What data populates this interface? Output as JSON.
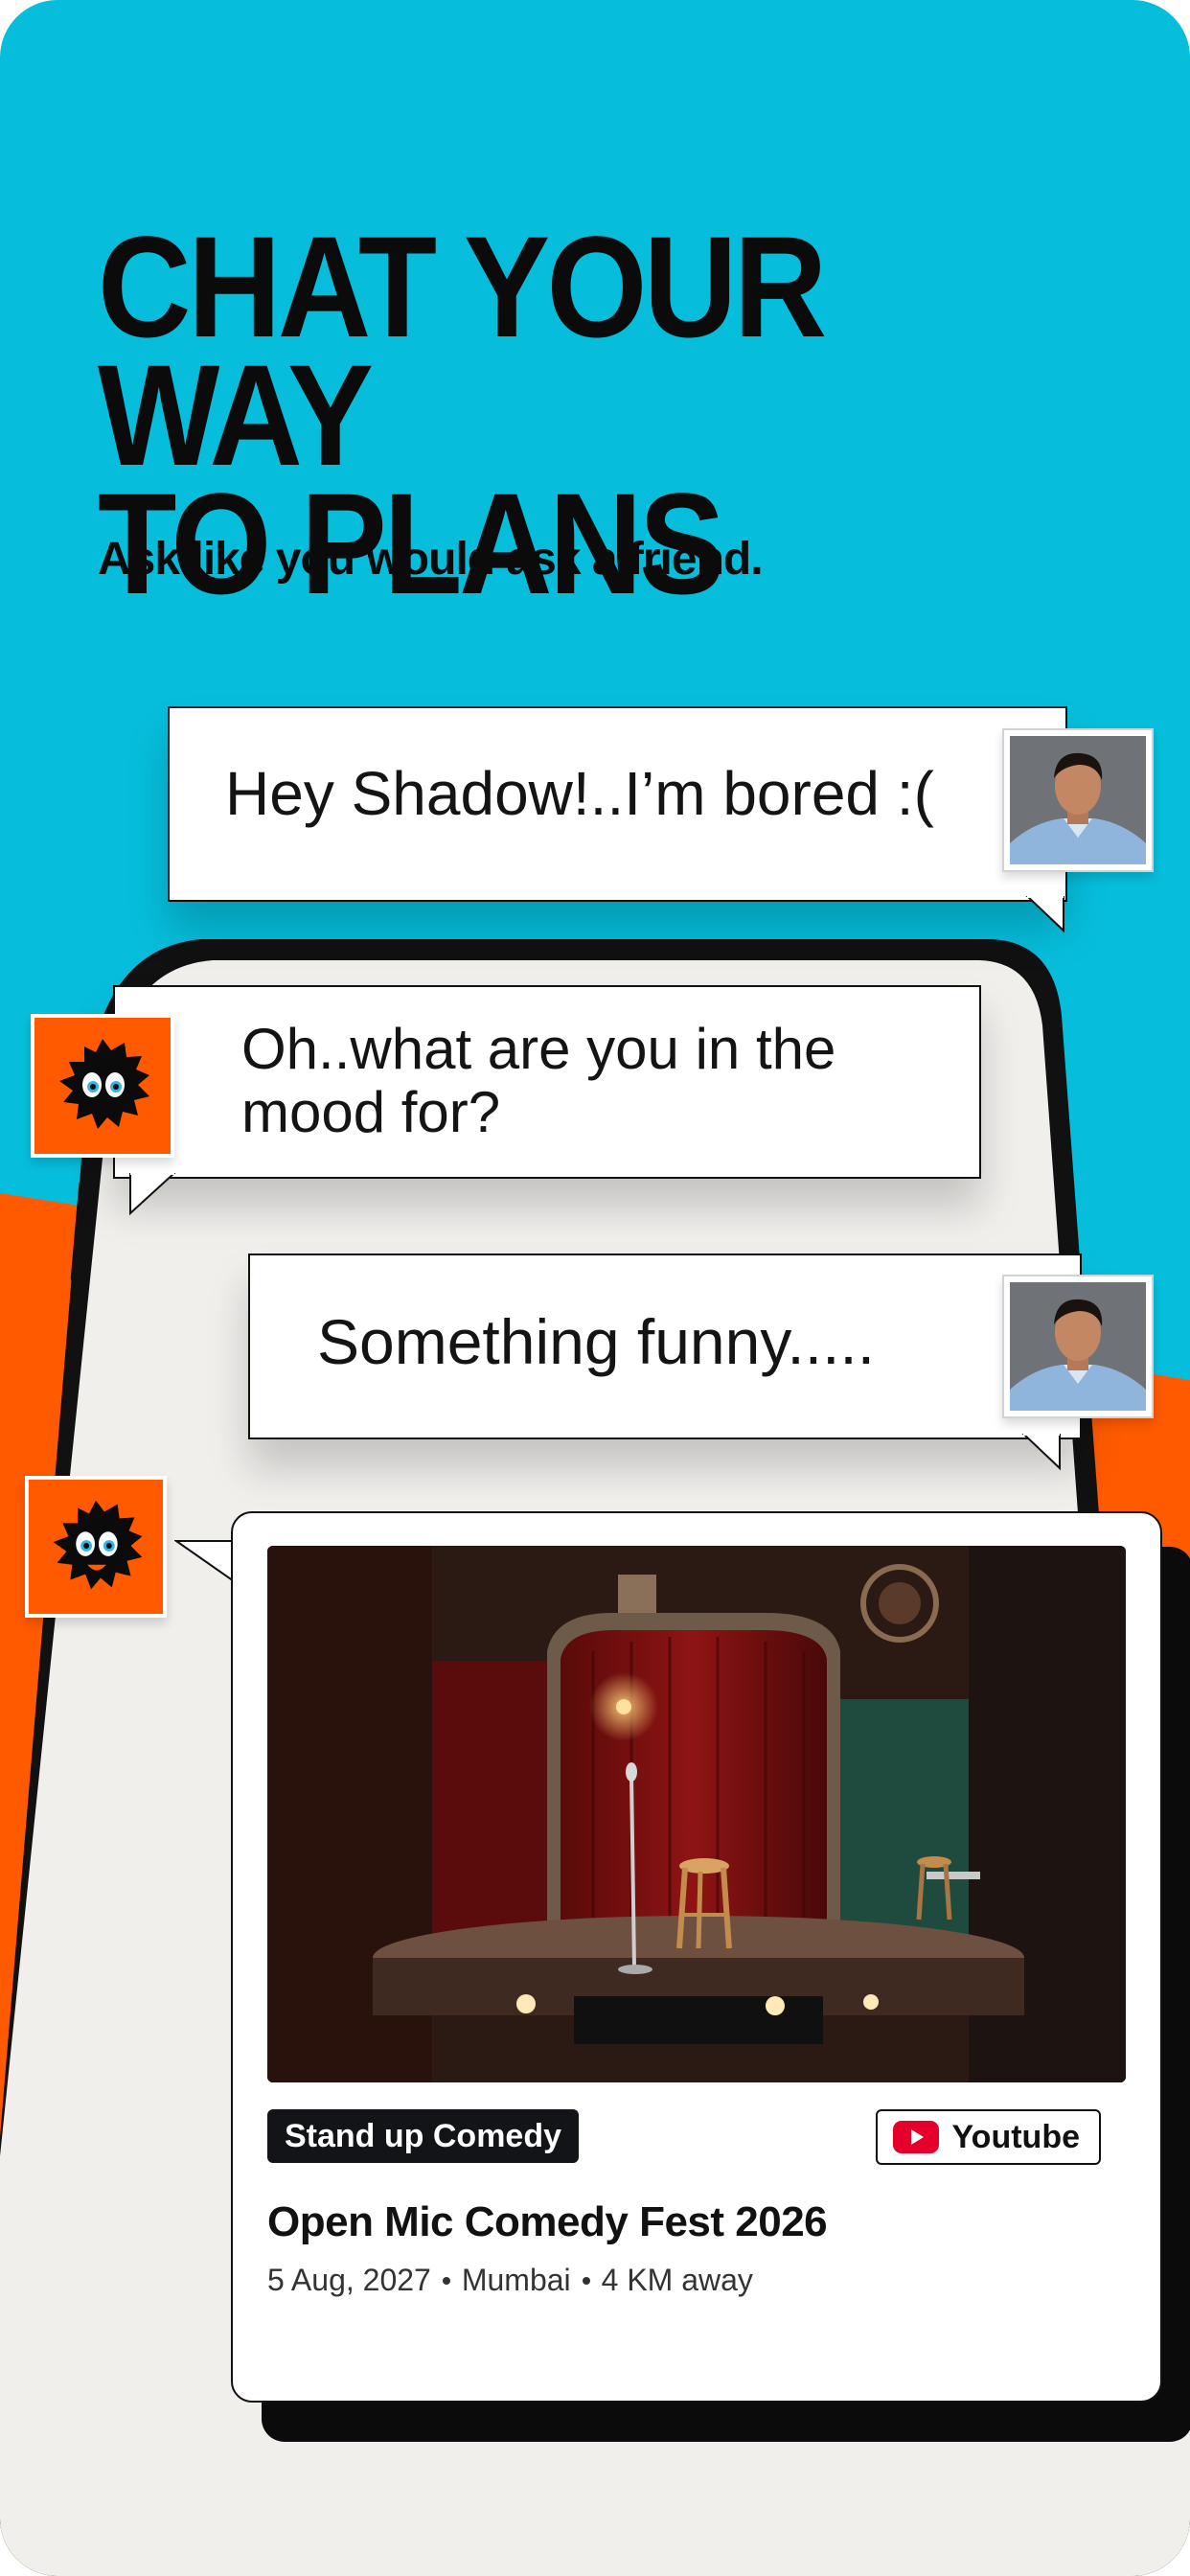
{
  "colors": {
    "background_cyan": "#06BEDC",
    "accent_orange": "#FF5A00",
    "ink": "#0B0B0B",
    "youtube_red": "#E4002B"
  },
  "hero": {
    "headline_line1": "CHAT YOUR WAY",
    "headline_line2": "TO PLANS",
    "subline": "Ask like you would ask a friend."
  },
  "chat": {
    "messages": [
      {
        "sender": "user",
        "text": "Hey Shadow!..I’m bored :("
      },
      {
        "sender": "bot",
        "text_line1": "Oh..what are you in the",
        "text_line2": "mood for?"
      },
      {
        "sender": "user",
        "text": "Something funny....."
      }
    ],
    "user_avatar_icon": "man-avatar-icon",
    "bot_avatar_icon": "shadow-mascot-icon"
  },
  "event_card": {
    "image_icon": "comedy-stage-image",
    "category": "Stand up Comedy",
    "source_label": "Youtube",
    "source_icon": "youtube-icon",
    "title": "Open Mic Comedy Fest 2026",
    "date": "5 Aug, 2027",
    "city": "Mumbai",
    "distance": "4 KM away"
  }
}
